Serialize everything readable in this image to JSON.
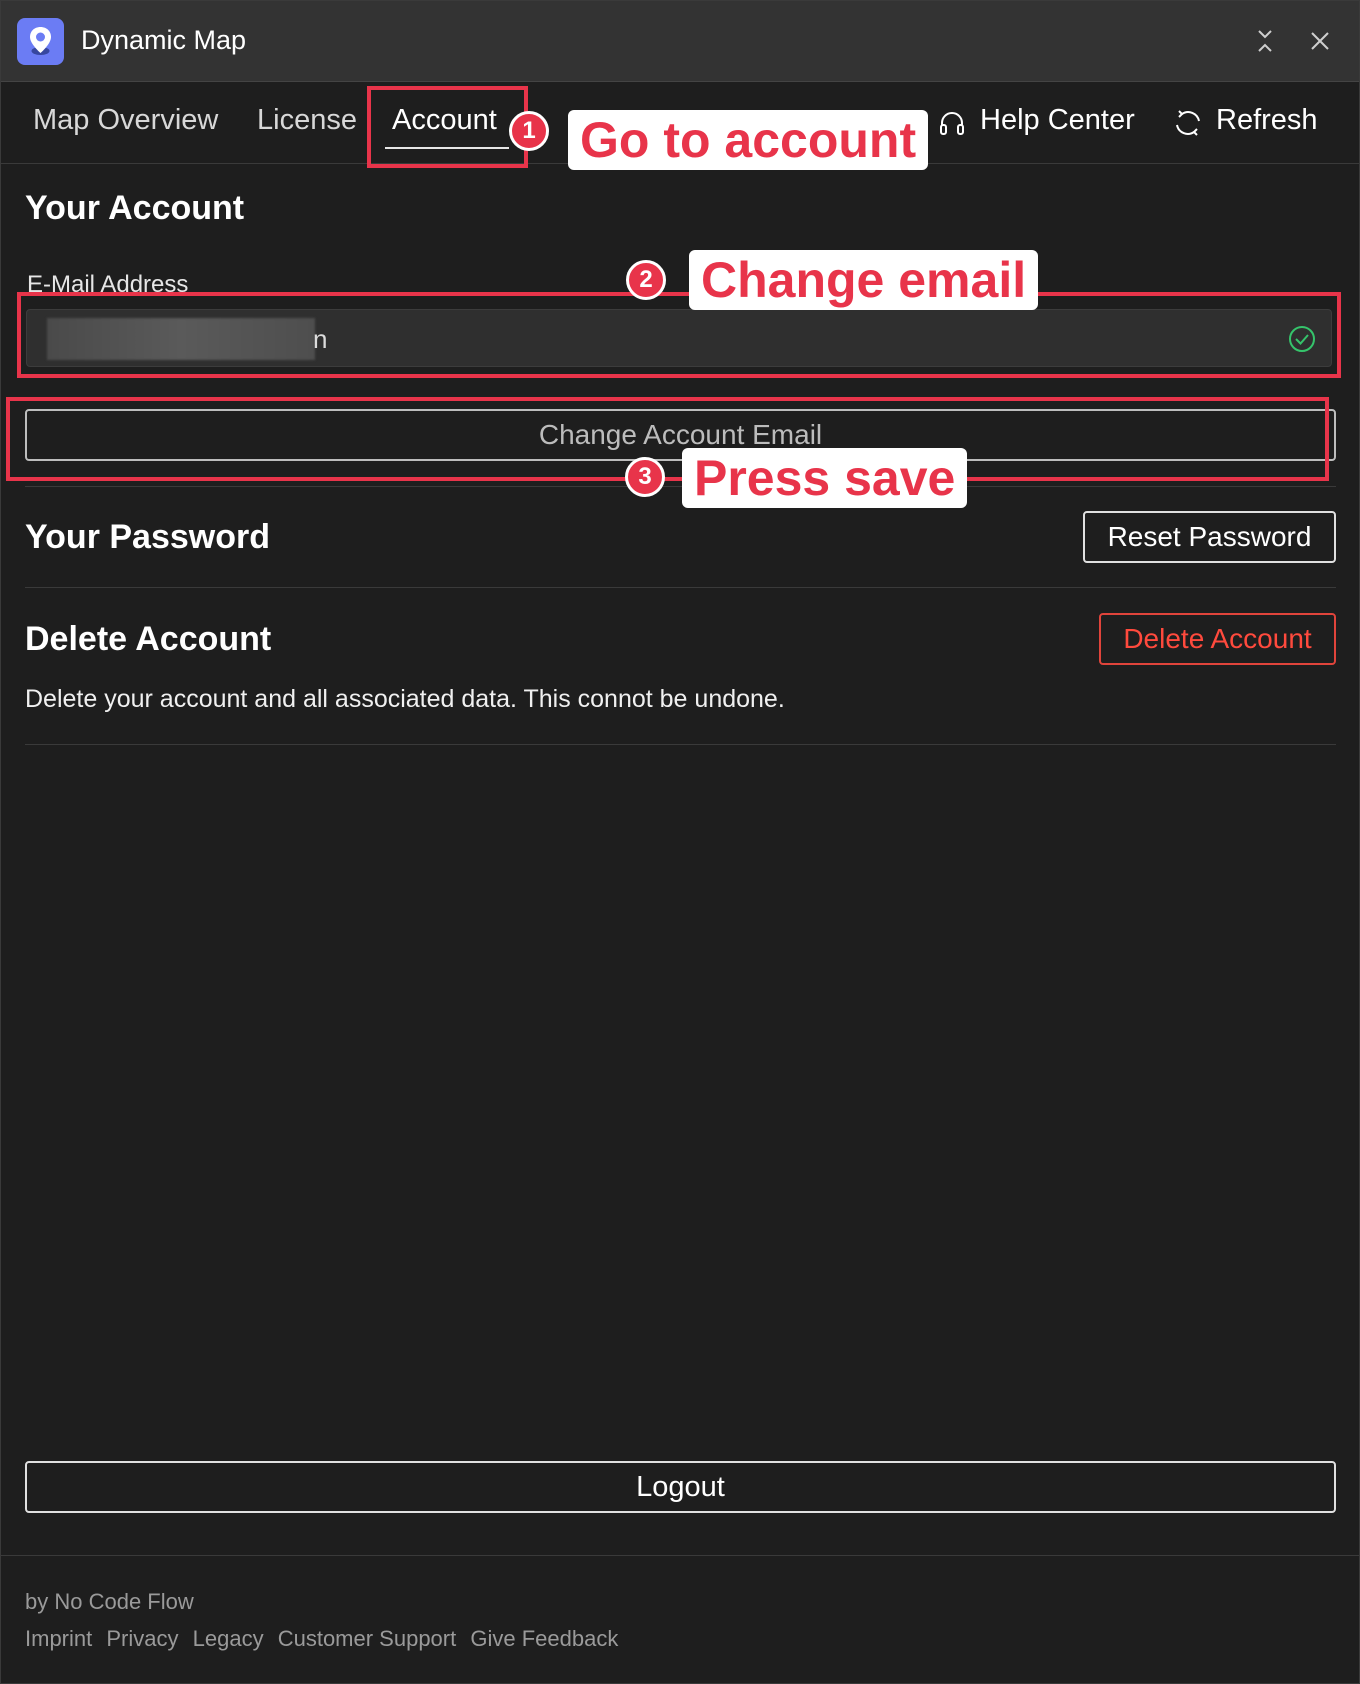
{
  "window": {
    "title": "Dynamic Map",
    "colors": {
      "background": "#1e1e1e",
      "titlebar": "#333333",
      "accent": "#6b7cf4",
      "danger": "#ff4a3d",
      "annotation": "#e8344a"
    }
  },
  "tabs": [
    {
      "label": "Map Overview",
      "active": false
    },
    {
      "label": "License",
      "active": false
    },
    {
      "label": "Account",
      "active": true
    }
  ],
  "toolbar": {
    "help_label": "Help Center",
    "help_icon": "headphones-icon",
    "refresh_label": "Refresh",
    "refresh_icon": "refresh-icon"
  },
  "account": {
    "heading": "Your Account",
    "email_label": "E-Mail Address",
    "email_value_visible": "n",
    "email_valid_icon": "check-circle-icon",
    "change_email_button": "Change Account Email"
  },
  "password": {
    "heading": "Your Password",
    "reset_button": "Reset Password"
  },
  "delete": {
    "heading": "Delete Account",
    "button": "Delete Account",
    "description": "Delete your account and all associated data. This connot be undone."
  },
  "logout_button": "Logout",
  "footer": {
    "by": "by No Code Flow",
    "links": [
      "Imprint",
      "Privacy",
      "Legacy",
      "Customer Support",
      "Give Feedback"
    ]
  },
  "annotations": [
    {
      "number": "1",
      "text": "Go to account"
    },
    {
      "number": "2",
      "text": "Change email"
    },
    {
      "number": "3",
      "text": "Press save"
    }
  ]
}
